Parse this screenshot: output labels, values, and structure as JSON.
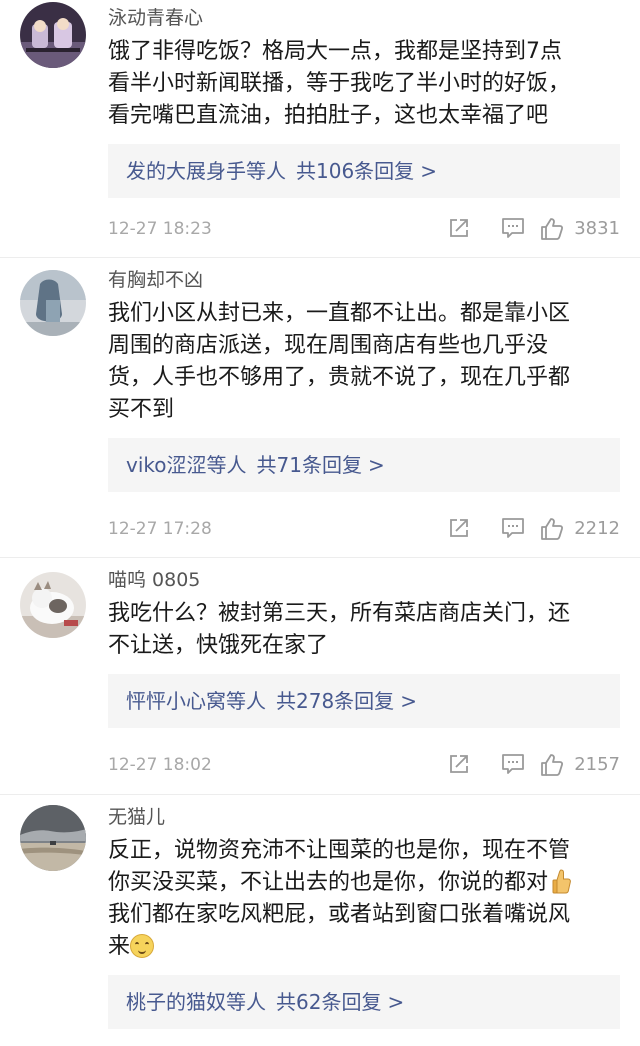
{
  "comments": [
    {
      "username": "泳动青春心",
      "lines": [
        "饿了非得吃饭？格局大一点，我都是坚持到7点",
        "看半小时新闻联播，等于我吃了半小时的好饭，",
        "看完嘴巴直流油，拍拍肚子，这也太幸福了吧"
      ],
      "replies": {
        "users": "发的大展身手",
        "etc": "等人",
        "count": "共106条回复",
        "arrow": ">"
      },
      "time": "12-27 18:23",
      "likes": "3831"
    },
    {
      "username": "有胸却不凶",
      "lines": [
        "我们小区从封已来，一直都不让出。都是靠小区",
        "周围的商店派送，现在周围商店有些也几乎没",
        "货，人手也不够用了，贵就不说了，现在几乎都",
        "买不到"
      ],
      "replies": {
        "users": "viko涩涩",
        "etc": "等人",
        "count": "共71条回复",
        "arrow": ">"
      },
      "time": "12-27 17:28",
      "likes": "2212"
    },
    {
      "username": "喵呜 0805",
      "lines": [
        "我吃什么？被封第三天，所有菜店商店关门，还",
        "不让送，快饿死在家了"
      ],
      "replies": {
        "users": "怦怦小心窝",
        "etc": "等人",
        "count": "共278条回复",
        "arrow": ">"
      },
      "time": "12-27 18:02",
      "likes": "2157"
    },
    {
      "username": "无猫儿",
      "lines": [
        "反正，说物资充沛不让囤菜的也是你，现在不管",
        "你买没买菜，不让出去的也是你，你说的都对",
        "我们都在家吃风粑屁，或者站到窗口张着嘴说风",
        "来"
      ],
      "replies": {
        "users": "桃子的猫奴",
        "etc": "等人",
        "count": "共62条回复",
        "arrow": ">"
      },
      "icons": {
        "inline_1": "thumbs-up-emoji",
        "inline_2": "smile-emoji"
      }
    }
  ],
  "icons": {
    "share": "share-icon",
    "reply": "comment-icon",
    "like": "thumbs-up-icon"
  },
  "colors": {
    "link": "#47598f",
    "meta": "#a8a8a8",
    "reply_bg": "#f5f5f5"
  }
}
